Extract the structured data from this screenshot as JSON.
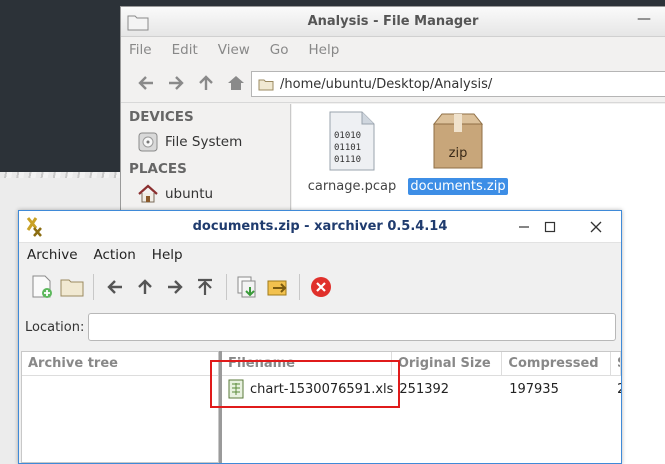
{
  "file_manager": {
    "title": "Analysis - File Manager",
    "menu": [
      "File",
      "Edit",
      "View",
      "Go",
      "Help"
    ],
    "path": "/home/ubuntu/Desktop/Analysis/",
    "sidebar": {
      "devices_header": "DEVICES",
      "devices": [
        {
          "label": "File System",
          "icon": "drive-icon"
        }
      ],
      "places_header": "PLACES",
      "places": [
        {
          "label": "ubuntu",
          "icon": "home-icon"
        }
      ]
    },
    "files": [
      {
        "name": "carnage.pcap",
        "icon": "binary-file-icon",
        "selected": false
      },
      {
        "name": "documents.zip",
        "icon": "zip-archive-icon",
        "selected": true
      }
    ]
  },
  "xarchiver": {
    "title": "documents.zip - xarchiver 0.5.4.14",
    "menu": [
      "Archive",
      "Action",
      "Help"
    ],
    "location_label": "Location:",
    "location_value": "",
    "tree_header": "Archive tree",
    "columns": [
      "Filename",
      "Original Size",
      "Compressed",
      "S"
    ],
    "rows": [
      {
        "filename": "chart-1530076591.xls",
        "original_size": "251392",
        "compressed": "197935",
        "extra": "2"
      }
    ]
  },
  "colors": {
    "selection": "#3d8ee6",
    "highlight_box": "#e01b1b",
    "xarchiver_border": "#3f8ad8",
    "close_button": "#e0302b"
  }
}
